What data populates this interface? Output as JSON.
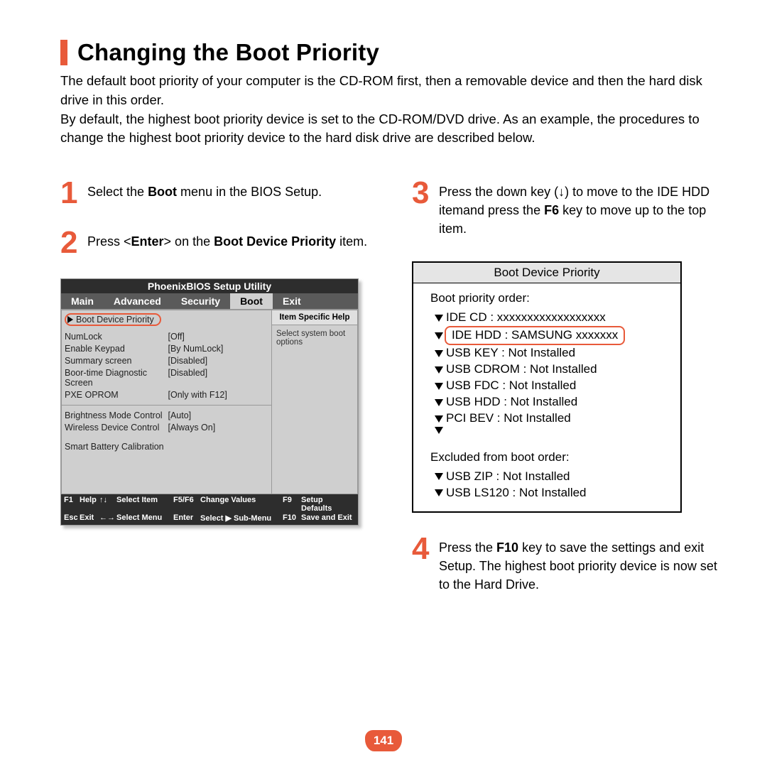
{
  "title": "Changing the Boot Priority",
  "intro_p1": "The default boot priority of your computer is the CD-ROM first, then a removable device and then the hard disk drive in this order.",
  "intro_p2": "By default, the highest boot priority device is set to the CD-ROM/DVD drive. As an example, the procedures to change the highest boot priority device to the hard disk drive are described below.",
  "steps": {
    "s1": {
      "num": "1",
      "pre": "Select the ",
      "bold": "Boot",
      "post": " menu in the BIOS Setup."
    },
    "s2": {
      "num": "2",
      "pre": "Press <",
      "b1": "Enter",
      "mid": "> on the ",
      "b2": "Boot Device Priority",
      "post": " item."
    },
    "s3": {
      "num": "3",
      "pre": "Press the down key (↓) to move to the IDE HDD itemand press the ",
      "bold": "F6",
      "post": " key to move up to the top item."
    },
    "s4": {
      "num": "4",
      "pre": "Press the ",
      "bold": "F10",
      "post": " key to save the settings and exit Setup. The highest boot priority device is now set to the Hard Drive."
    }
  },
  "bios": {
    "utility_title": "PhoenixBIOS Setup Utility",
    "tabs": [
      "Main",
      "Advanced",
      "Security",
      "Boot",
      "Exit"
    ],
    "active_tab_index": 3,
    "selected_item": "Boot Device Priority",
    "rows": [
      {
        "label": "NumLock",
        "value": "[Off]"
      },
      {
        "label": "Enable Keypad",
        "value": "[By NumLock]"
      },
      {
        "label": "Summary screen",
        "value": "[Disabled]"
      },
      {
        "label": "Boor-time Diagnostic Screen",
        "value": "[Disabled]"
      },
      {
        "label": "PXE OPROM",
        "value": "[Only with F12]"
      }
    ],
    "rows2": [
      {
        "label": "Brightness Mode Control",
        "value": "[Auto]"
      },
      {
        "label": "Wireless Device Control",
        "value": "[Always On]"
      }
    ],
    "row_span": "Smart Battery Calibration",
    "help_title": "Item Specific Help",
    "help_body": "Select system boot options",
    "footer": {
      "r1": [
        "F1",
        "Help",
        "↑↓",
        "Select Item",
        "F5/F6",
        "Change Values",
        "F9",
        "Setup Defaults"
      ],
      "r2": [
        "Esc",
        "Exit",
        "←→",
        "Select Menu",
        "Enter",
        "Select ▶ Sub-Menu",
        "F10",
        "Save and Exit"
      ]
    }
  },
  "bdp": {
    "title": "Boot Device Priority",
    "order_label": "Boot priority order:",
    "items": [
      "IDE CD : xxxxxxxxxxxxxxxxxx",
      "IDE HDD : SAMSUNG xxxxxxx",
      "USB KEY : Not Installed",
      "USB CDROM : Not Installed",
      "USB FDC : Not Installed",
      "USB HDD : Not Installed",
      "PCI BEV : Not Installed"
    ],
    "highlight_index": 1,
    "excluded_label": "Excluded from boot order:",
    "excluded": [
      "USB ZIP : Not Installed",
      "USB LS120 : Not Installed"
    ]
  },
  "page_number": "141"
}
